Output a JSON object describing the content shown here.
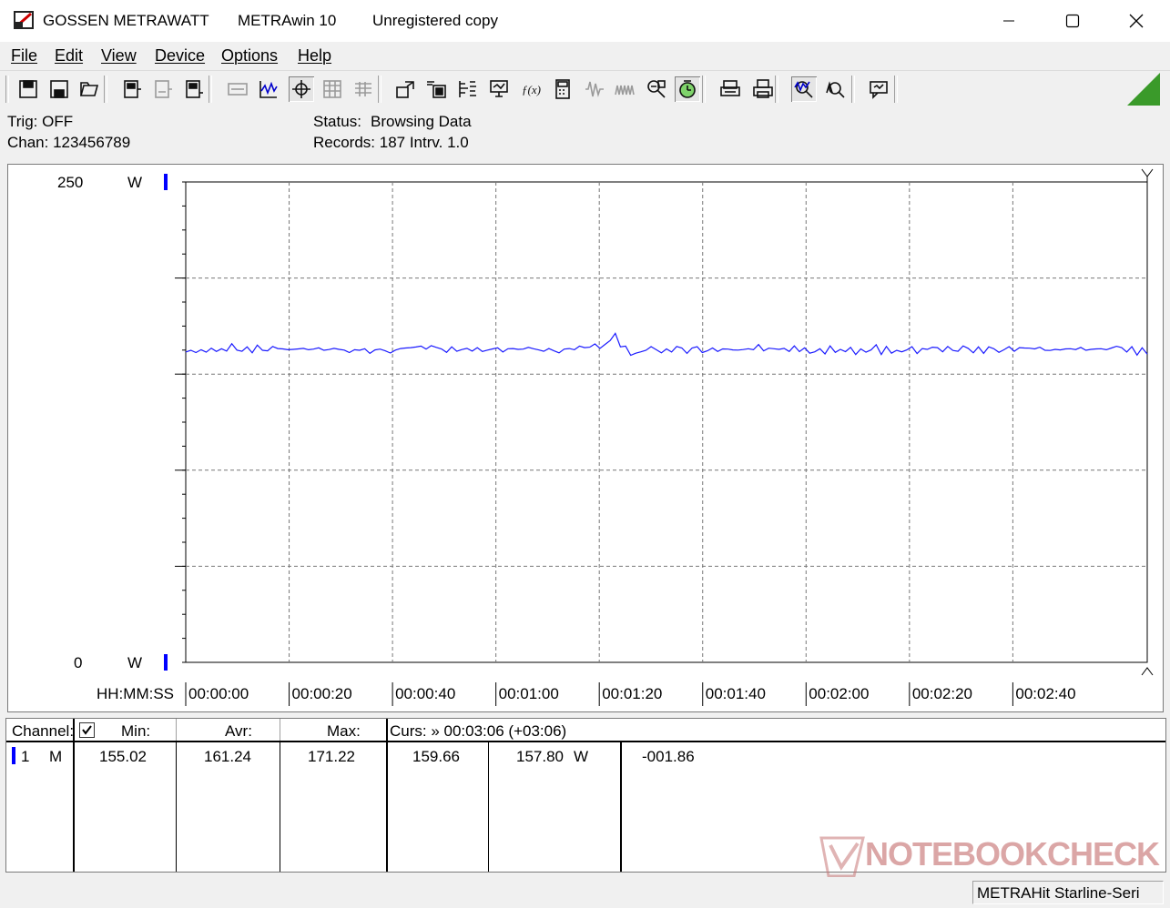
{
  "titlebar": {
    "vendor": "GOSSEN METRAWATT",
    "app": "METRAwin 10",
    "note": "Unregistered copy"
  },
  "menu": [
    "File",
    "Edit",
    "View",
    "Device",
    "Options",
    "Help"
  ],
  "toolbar_icons": [
    "save-icon",
    "save-as-icon",
    "open-icon",
    "meter-read-icon",
    "meter-settings-icon",
    "meter-icon",
    "digital-display-icon",
    "chart-view-icon",
    "cursor-view-icon",
    "table-view-icon",
    "list-view-icon",
    "export-icon",
    "import-icon",
    "config-icon",
    "pc-icon",
    "formula-icon",
    "calculator-icon",
    "wave-icon",
    "wave2-icon",
    "process-icon",
    "timer-icon",
    "print-preview-icon",
    "print-icon",
    "zoom-icon",
    "zoom-area-icon",
    "info-icon"
  ],
  "info": {
    "trig": "Trig: OFF",
    "chan": "Chan:  123456789",
    "status_label": "Status:",
    "status_value": "Browsing Data",
    "records": "Records: 187   Intrv. 1.0"
  },
  "chart_data": {
    "type": "line",
    "y_max_label": "250",
    "y_min_label": "0",
    "y_unit": "W",
    "ylim": [
      0,
      250
    ],
    "x_axis_label": "HH:MM:SS",
    "x_ticks": [
      "00:00:00",
      "00:00:20",
      "00:00:40",
      "00:01:00",
      "00:01:20",
      "00:01:40",
      "00:02:00",
      "00:02:20",
      "00:02:40"
    ],
    "x_range_seconds": [
      0,
      186
    ],
    "grid": true,
    "series": [
      {
        "color": "#1a1aff",
        "values": [
          161.5,
          162.4,
          161.2,
          162.7,
          161.4,
          163.5,
          161.8,
          163.2,
          162.0,
          165.8,
          162.5,
          161.9,
          164.2,
          161.1,
          165.1,
          162.4,
          162.1,
          164.4,
          163.3,
          163.1,
          162.7,
          162.9,
          163.1,
          163.4,
          162.7,
          163.0,
          163.7,
          162.4,
          162.8,
          163.4,
          162.9,
          162.5,
          161.2,
          162.7,
          162.4,
          163.2,
          160.8,
          162.6,
          163.0,
          162.1,
          161.0,
          162.5,
          163.3,
          163.6,
          163.8,
          164.1,
          164.6,
          163.0,
          164.8,
          163.9,
          163.1,
          161.3,
          164.2,
          161.9,
          162.8,
          163.4,
          162.0,
          163.8,
          161.8,
          162.5,
          163.1,
          163.7,
          161.5,
          163.2,
          163.3,
          162.9,
          163.0,
          163.9,
          163.2,
          162.6,
          161.9,
          163.3,
          162.1,
          161.1,
          163.0,
          163.3,
          162.7,
          164.6,
          163.8,
          164.0,
          165.7,
          163.4,
          165.5,
          167.5,
          171.2,
          164.2,
          164.6,
          159.8,
          160.9,
          161.6,
          162.4,
          164.3,
          162.7,
          161.1,
          163.1,
          161.5,
          164.4,
          163.6,
          160.8,
          163.6,
          164.3,
          161.2,
          162.1,
          163.6,
          161.8,
          163.1,
          163.0,
          162.6,
          162.5,
          162.8,
          163.2,
          162.7,
          165.4,
          162.1,
          163.5,
          163.2,
          162.9,
          163.4,
          161.8,
          164.7,
          161.7,
          163.7,
          160.9,
          161.6,
          163.2,
          160.5,
          164.7,
          161.3,
          162.9,
          161.7,
          163.9,
          160.2,
          163.1,
          161.4,
          162.6,
          165.3,
          160.2,
          164.4,
          160.9,
          162.4,
          161.6,
          162.6,
          164.3,
          160.7,
          163.3,
          162.9,
          164.0,
          163.8,
          161.6,
          164.4,
          162.3,
          161.9,
          164.7,
          163.4,
          161.1,
          164.2,
          160.8,
          164.2,
          163.2,
          161.3,
          162.7,
          164.3,
          161.9,
          163.8,
          163.6,
          163.5,
          163.1,
          164.0,
          162.4,
          162.3,
          162.9,
          162.6,
          163.1,
          163.2,
          162.8,
          163.9,
          162.4,
          162.9,
          163.1,
          163.2,
          162.7,
          163.6,
          164.5,
          163.8,
          161.5,
          164.3,
          159.9,
          163.7,
          160.4
        ]
      }
    ]
  },
  "table": {
    "headers": {
      "channel": "Channel:",
      "min": "Min:",
      "avr": "Avr:",
      "max": "Max:",
      "curs": "Curs: » 00:03:06 (+03:06)"
    },
    "row": {
      "num": "1",
      "mode": "M",
      "min": "155.02",
      "avr": "161.24",
      "max": "171.22",
      "curs1": "159.66",
      "curs2": "157.80",
      "unit": "W",
      "diff": "-001.86"
    }
  },
  "watermark": "NOTEBOOKCHECK",
  "status_device": "METRAHit Starline-Seri",
  "colors": {
    "channel": "#0000ff",
    "trace": "#1a1aff",
    "window": "#f0f0f0"
  }
}
